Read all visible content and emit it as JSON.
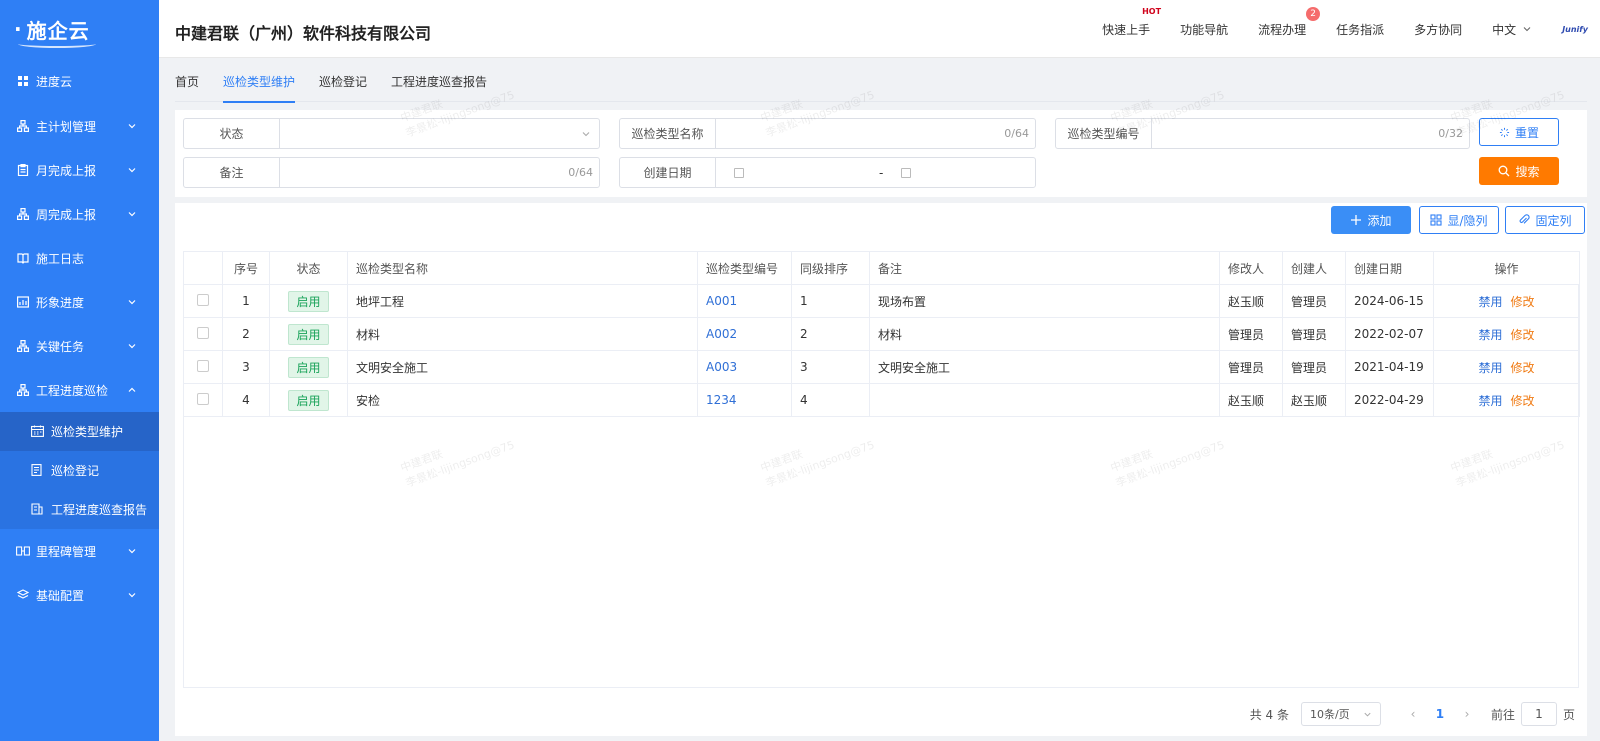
{
  "logo": {
    "text": "施企云"
  },
  "sidebar": {
    "items": [
      {
        "label": "进度云",
        "icon": "grid-icon"
      },
      {
        "label": "主计划管理",
        "icon": "hierarchy-icon"
      },
      {
        "label": "月完成上报",
        "icon": "clipboard-icon"
      },
      {
        "label": "周完成上报",
        "icon": "hierarchy-icon"
      },
      {
        "label": "施工日志",
        "icon": "book-icon"
      },
      {
        "label": "形象进度",
        "icon": "chart-icon"
      },
      {
        "label": "关键任务",
        "icon": "hierarchy-icon"
      },
      {
        "label": "工程进度巡检",
        "icon": "hierarchy-icon"
      }
    ],
    "sub_items": [
      {
        "label": "巡检类型维护",
        "icon": "calendar-icon"
      },
      {
        "label": "巡检登记",
        "icon": "document-icon"
      },
      {
        "label": "工程进度巡查报告",
        "icon": "report-icon"
      }
    ],
    "bottom_items": [
      {
        "label": "里程碑管理",
        "icon": "milestone-icon"
      },
      {
        "label": "基础配置",
        "icon": "layers-icon"
      }
    ]
  },
  "header": {
    "company": "中建君联（广州）软件科技有限公司",
    "nav": [
      "快速上手",
      "功能导航",
      "流程办理",
      "任务指派",
      "多方协同"
    ],
    "hot_label": "HOT",
    "badge": "2",
    "lang": "中文",
    "brand": "Junify"
  },
  "tabs": [
    "首页",
    "巡检类型维护",
    "巡检登记",
    "工程进度巡查报告"
  ],
  "filter": {
    "status_label": "状态",
    "name_label": "巡检类型名称",
    "name_count": "0/64",
    "code_label": "巡检类型编号",
    "code_count": "0/32",
    "remark_label": "备注",
    "remark_count": "0/64",
    "date_label": "创建日期",
    "date_sep": "-",
    "reset_label": "重置",
    "search_label": "搜索"
  },
  "toolbar": {
    "add_label": "添加",
    "show_hide_label": "显/隐列",
    "fix_col_label": "固定列"
  },
  "table": {
    "headers": [
      "序号",
      "状态",
      "巡检类型名称",
      "巡检类型编号",
      "同级排序",
      "备注",
      "修改人",
      "创建人",
      "创建日期",
      "操作"
    ],
    "rows": [
      {
        "no": "1",
        "status": "启用",
        "name": "地坪工程",
        "code": "A001",
        "sort": "1",
        "remark": "现场布置",
        "modifier": "赵玉顺",
        "creator": "管理员",
        "date": "2024-06-15"
      },
      {
        "no": "2",
        "status": "启用",
        "name": "材料",
        "code": "A002",
        "sort": "2",
        "remark": "材料",
        "modifier": "管理员",
        "creator": "管理员",
        "date": "2022-02-07"
      },
      {
        "no": "3",
        "status": "启用",
        "name": "文明安全施工",
        "code": "A003",
        "sort": "3",
        "remark": "文明安全施工",
        "modifier": "管理员",
        "creator": "管理员",
        "date": "2021-04-19"
      },
      {
        "no": "4",
        "status": "启用",
        "name": "安检",
        "code": "1234",
        "sort": "4",
        "remark": "",
        "modifier": "赵玉顺",
        "creator": "赵玉顺",
        "date": "2022-04-29"
      }
    ],
    "op_disable": "禁用",
    "op_edit": "修改"
  },
  "pager": {
    "total": "共 4 条",
    "size": "10条/页",
    "current": "1",
    "goto_prefix": "前往",
    "goto_value": "1",
    "goto_suffix": "页"
  },
  "watermark": {
    "line1": "中建君联",
    "line2": "李景松-lijingsong@75"
  },
  "colors": {
    "sidebar": "#2f7ff5",
    "accent": "#2f7ff5",
    "orange": "#ff7a00",
    "status_green": "#1aa35a"
  }
}
